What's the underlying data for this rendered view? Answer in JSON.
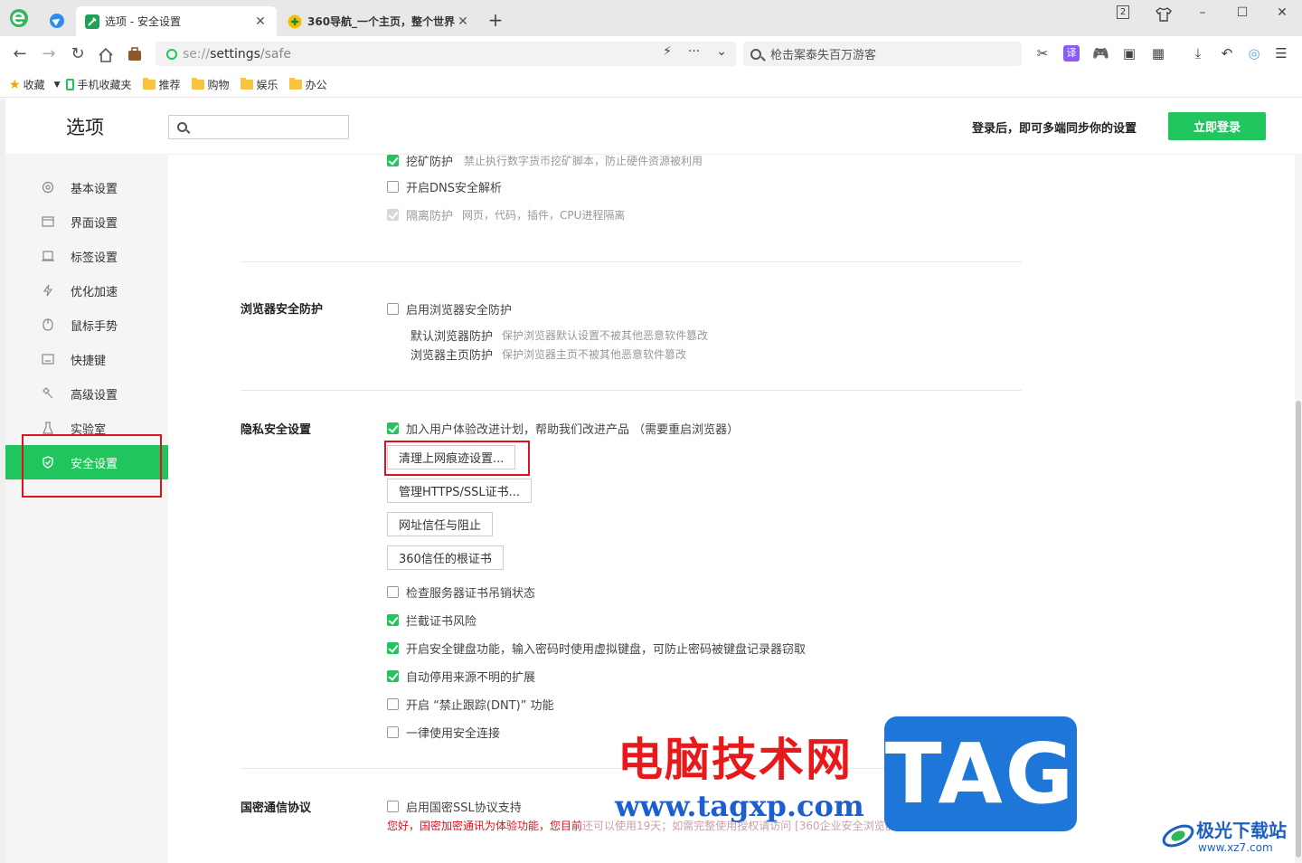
{
  "tabs": [
    {
      "title": "选项 - 安全设置",
      "close": "✕"
    },
    {
      "title": "360导航_一个主页，整个世界",
      "close": "✕"
    }
  ],
  "window": {
    "tab_count": "2"
  },
  "toolbar": {
    "url_scheme": "se://",
    "url_host": "settings",
    "url_path": "/safe",
    "search_text": "枪击案泰失百万游客"
  },
  "bookmarks": {
    "favorites": "收藏",
    "items": [
      "手机收藏夹",
      "推荐",
      "购物",
      "娱乐",
      "办公"
    ]
  },
  "header": {
    "title": "选项",
    "search_placeholder": "",
    "login_hint": "登录后，即可多端同步你的设置",
    "login_button": "立即登录"
  },
  "sidebar": {
    "items": [
      {
        "label": "基本设置",
        "icon": "gear-icon"
      },
      {
        "label": "界面设置",
        "icon": "window-icon"
      },
      {
        "label": "标签设置",
        "icon": "tab-icon"
      },
      {
        "label": "优化加速",
        "icon": "lightning-icon"
      },
      {
        "label": "鼠标手势",
        "icon": "mouse-icon"
      },
      {
        "label": "快捷键",
        "icon": "keyboard-icon"
      },
      {
        "label": "高级设置",
        "icon": "wrench-icon"
      },
      {
        "label": "实验室",
        "icon": "flask-icon"
      },
      {
        "label": "安全设置",
        "icon": "shield-icon",
        "active": true
      }
    ]
  },
  "content": {
    "top_rows": [
      {
        "label": "挖矿防护",
        "desc": "禁止执行数字货币挖矿脚本，防止硬件资源被利用",
        "state": "checked"
      },
      {
        "label": "开启DNS安全解析",
        "desc": "",
        "state": "unchecked"
      },
      {
        "label": "隔离防护",
        "desc": "网页，代码，插件，CPU进程隔离",
        "state": "disabled-checked"
      }
    ],
    "browser_protect": {
      "title": "浏览器安全防护",
      "enable_label": "启用浏览器安全防护",
      "sub1_label": "默认浏览器防护",
      "sub1_desc": "保护浏览器默认设置不被其他恶意软件篡改",
      "sub2_label": "浏览器主页防护",
      "sub2_desc": "保护浏览器主页不被其他恶意软件篡改"
    },
    "privacy": {
      "title": "隐私安全设置",
      "ux_plan": "加入用户体验改进计划，帮助我们改进产品 （需要重启浏览器）",
      "buttons": [
        "清理上网痕迹设置...",
        "管理HTTPS/SSL证书...",
        "网址信任与阻止",
        "360信任的根证书"
      ],
      "checks": [
        {
          "label": "检查服务器证书吊销状态",
          "state": "unchecked"
        },
        {
          "label": "拦截证书风险",
          "state": "checked"
        },
        {
          "label": "开启安全键盘功能，输入密码时使用虚拟键盘，可防止密码被键盘记录器窃取",
          "state": "checked"
        },
        {
          "label": "自动停用来源不明的扩展",
          "state": "checked"
        },
        {
          "label": "开启 “禁止跟踪(DNT)” 功能",
          "state": "unchecked"
        },
        {
          "label": "一律使用安全连接",
          "state": "unchecked"
        }
      ]
    },
    "gm": {
      "title": "国密通信协议",
      "enable_label": "启用国密SSL协议支持",
      "warning": "您好，国密加密通讯为体验功能，您目前",
      "warning_faded": "还可以使用19天；如需完整使用授权请访问 [360企业安全浏览器官网]"
    }
  },
  "watermark": {
    "cn": "电脑技术网",
    "url": "www.tagxp.com",
    "tag": "TAG",
    "jg_name": "极光下载站",
    "jg_url": "www.xz7.com"
  },
  "colors": {
    "accent": "#21c55d",
    "highlight": "#e0111e"
  }
}
